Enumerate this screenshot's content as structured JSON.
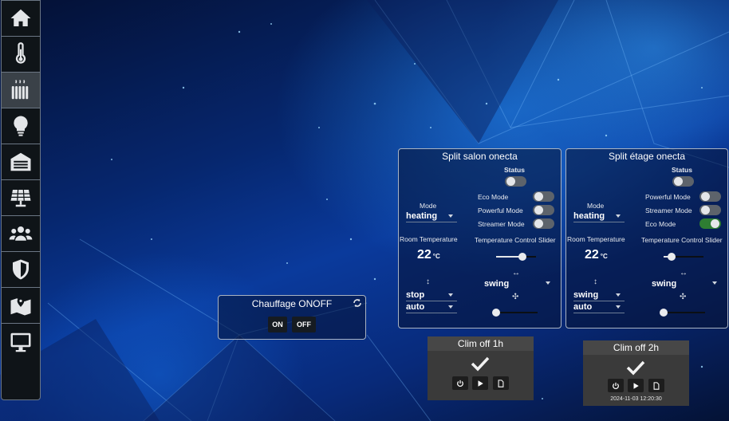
{
  "sidebar": {
    "items": [
      {
        "icon": "home-icon",
        "active": false
      },
      {
        "icon": "thermometer-icon",
        "active": false
      },
      {
        "icon": "radiator-icon",
        "active": true
      },
      {
        "icon": "lightbulb-icon",
        "active": false
      },
      {
        "icon": "garage-icon",
        "active": false
      },
      {
        "icon": "solar-panel-icon",
        "active": false
      },
      {
        "icon": "users-icon",
        "active": false
      },
      {
        "icon": "shield-icon",
        "active": false
      },
      {
        "icon": "map-icon",
        "active": false
      },
      {
        "icon": "monitor-icon",
        "active": false
      }
    ]
  },
  "chauffage": {
    "title": "Chauffage ONOFF",
    "on_label": "ON",
    "off_label": "OFF"
  },
  "split_salon": {
    "title": "Split salon onecta",
    "status_label": "Status",
    "status_on": false,
    "mode_label": "Mode",
    "mode_value": "heating",
    "room_temp_label": "Room Temperature",
    "room_temp_value": "22",
    "room_temp_unit": "°C",
    "toggles": [
      {
        "label": "Eco Mode",
        "on": false
      },
      {
        "label": "Powerful Mode",
        "on": false
      },
      {
        "label": "Streamer Mode",
        "on": false
      }
    ],
    "slider_label": "Temperature Control Slider",
    "slider_level": 0.65,
    "swing_h_value": "swing",
    "vertical_value": "stop",
    "fan_value": "auto",
    "fan_slider_level": 0.0
  },
  "split_etage": {
    "title": "Split étage onecta",
    "status_label": "Status",
    "status_on": false,
    "mode_label": "Mode",
    "mode_value": "heating",
    "room_temp_label": "Room Temperature",
    "room_temp_value": "22",
    "room_temp_unit": "°C",
    "toggles": [
      {
        "label": "Powerful Mode",
        "on": false
      },
      {
        "label": "Streamer Mode",
        "on": false
      },
      {
        "label": "Eco Mode",
        "on": true
      }
    ],
    "slider_label": "Temperature Control Slider",
    "slider_level": 0.2,
    "swing_h_value": "swing",
    "vertical_value": "swing",
    "fan_value": "auto",
    "fan_slider_level": 0.0
  },
  "clim1": {
    "title": "Clim off 1h",
    "timestamp": ""
  },
  "clim2": {
    "title": "Clim off 2h",
    "timestamp": "2024-11-03 12:20:30"
  },
  "colors": {
    "accent_green": "#2e7d32",
    "panel_border": "#a9b3c2"
  }
}
